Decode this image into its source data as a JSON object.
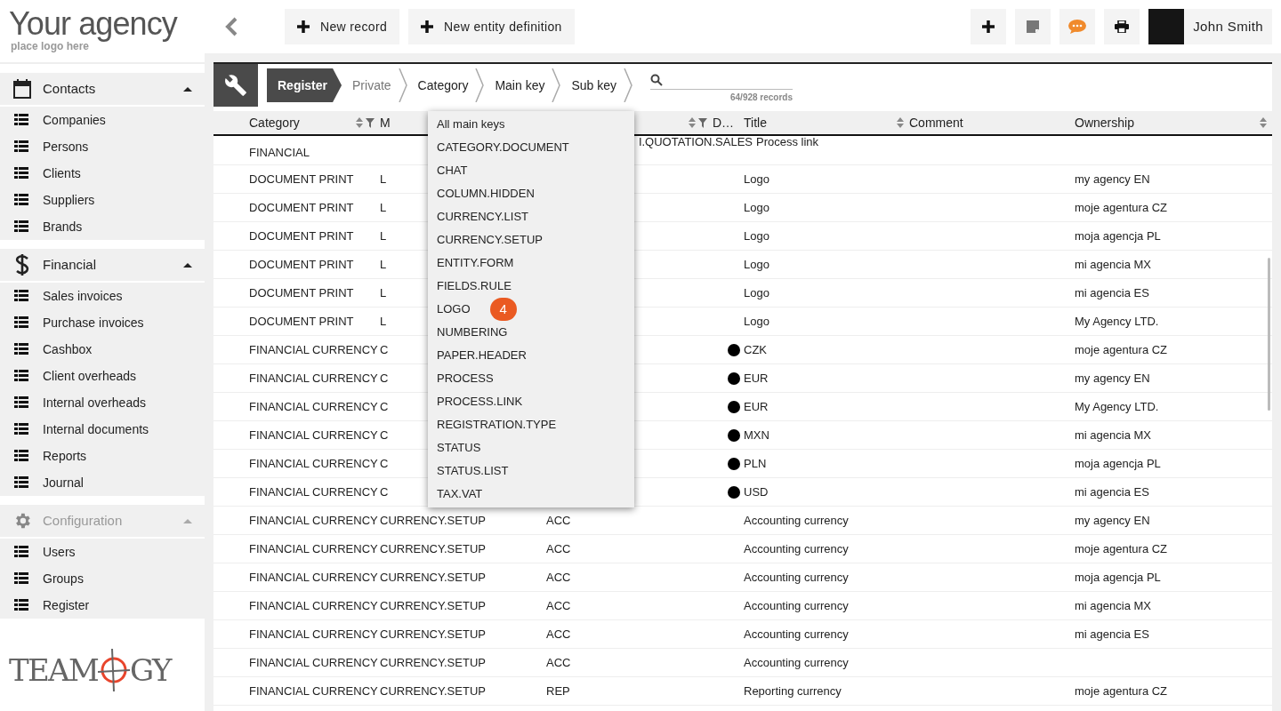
{
  "logo": {
    "title": "Your agency",
    "subtitle": "place logo here"
  },
  "toolbar": {
    "buttons": [
      {
        "label": "New record"
      },
      {
        "label": "New entity definition"
      }
    ],
    "icon_buttons": [
      {
        "kind": "plus"
      },
      {
        "kind": "note"
      },
      {
        "kind": "chat"
      },
      {
        "kind": "print"
      }
    ],
    "user": {
      "name": "John Smith"
    }
  },
  "sidebar": {
    "sections": [
      {
        "kind": "calendar",
        "label": "Contacts",
        "expanded": true,
        "disabled": false,
        "items": [
          "Companies",
          "Persons",
          "Clients",
          "Suppliers",
          "Brands"
        ]
      },
      {
        "kind": "dollar",
        "label": "Financial",
        "expanded": true,
        "disabled": false,
        "items": [
          "Sales invoices",
          "Purchase invoices",
          "Cashbox",
          "Client overheads",
          "Internal overheads",
          "Internal documents",
          "Reports",
          "Journal"
        ]
      },
      {
        "kind": "gear",
        "label": "Configuration",
        "expanded": true,
        "disabled": true,
        "items": [
          "Users",
          "Groups",
          "Register"
        ]
      }
    ],
    "brand": {
      "before": "TEAM",
      "after": "GY"
    }
  },
  "breadcrumb": [
    {
      "label": "Register",
      "selected": true,
      "disabled": false
    },
    {
      "label": "Private",
      "selected": false,
      "disabled": true
    },
    {
      "label": "Category",
      "selected": false,
      "disabled": false
    },
    {
      "label": "Main key",
      "selected": false,
      "disabled": false
    },
    {
      "label": "Sub key",
      "selected": false,
      "disabled": false
    }
  ],
  "search": {
    "count": "64/928 records"
  },
  "table": {
    "columns": [
      {
        "label": "Category",
        "sort": true,
        "filter": true
      },
      {
        "label": "M",
        "sort": false,
        "filter": false
      },
      {
        "sort": true,
        "filter": true
      },
      {
        "label": "D…",
        "sort": false,
        "filter": false
      },
      {
        "label": "Title",
        "sort": true,
        "filter": false
      },
      {
        "label": "Comment",
        "sort": false,
        "filter": false
      },
      {
        "label": "Ownership",
        "sort": true,
        "filter": false
      }
    ],
    "rows": [
      {
        "category": "FINANCIAL",
        "main_key": "",
        "sub_key": "",
        "covered_key_tail": "I.QUOTATION.SALES",
        "default": false,
        "title": "Process link",
        "ownership": ""
      },
      {
        "category": "DOCUMENT PRINT",
        "main_key": "L",
        "sub_key": "",
        "default": false,
        "title": "Logo",
        "ownership": "my agency EN"
      },
      {
        "category": "DOCUMENT PRINT",
        "main_key": "L",
        "sub_key": "",
        "default": false,
        "title": "Logo",
        "ownership": "moje agentura CZ"
      },
      {
        "category": "DOCUMENT PRINT",
        "main_key": "L",
        "sub_key": "",
        "default": false,
        "title": "Logo",
        "ownership": "moja agencja PL"
      },
      {
        "category": "DOCUMENT PRINT",
        "main_key": "L",
        "sub_key": "",
        "default": false,
        "title": "Logo",
        "ownership": "mi agencia MX"
      },
      {
        "category": "DOCUMENT PRINT",
        "main_key": "L",
        "sub_key": "",
        "default": false,
        "title": "Logo",
        "ownership": "mi agencia ES"
      },
      {
        "category": "DOCUMENT PRINT",
        "main_key": "L",
        "sub_key": "",
        "default": false,
        "title": "Logo",
        "ownership": "My Agency LTD."
      },
      {
        "category": "FINANCIAL CURRENCY",
        "main_key": "C",
        "sub_key": "",
        "default": true,
        "title": "CZK",
        "ownership": "moje agentura CZ"
      },
      {
        "category": "FINANCIAL CURRENCY",
        "main_key": "C",
        "sub_key": "",
        "default": true,
        "title": "EUR",
        "ownership": "my agency EN"
      },
      {
        "category": "FINANCIAL CURRENCY",
        "main_key": "C",
        "sub_key": "",
        "default": true,
        "title": "EUR",
        "ownership": "My Agency LTD."
      },
      {
        "category": "FINANCIAL CURRENCY",
        "main_key": "C",
        "sub_key": "",
        "default": true,
        "title": "MXN",
        "ownership": "mi agencia MX"
      },
      {
        "category": "FINANCIAL CURRENCY",
        "main_key": "C",
        "sub_key": "",
        "default": true,
        "title": "PLN",
        "ownership": "moja agencja PL"
      },
      {
        "category": "FINANCIAL CURRENCY",
        "main_key": "C",
        "sub_key": "",
        "default": true,
        "title": "USD",
        "ownership": "mi agencia ES"
      },
      {
        "category": "FINANCIAL CURRENCY",
        "main_key": "CURRENCY.SETUP",
        "sub_key": "ACC",
        "default": false,
        "title": "Accounting currency",
        "ownership": "my agency EN"
      },
      {
        "category": "FINANCIAL CURRENCY",
        "main_key": "CURRENCY.SETUP",
        "sub_key": "ACC",
        "default": false,
        "title": "Accounting currency",
        "ownership": "moje agentura CZ"
      },
      {
        "category": "FINANCIAL CURRENCY",
        "main_key": "CURRENCY.SETUP",
        "sub_key": "ACC",
        "default": false,
        "title": "Accounting currency",
        "ownership": "moja agencja PL"
      },
      {
        "category": "FINANCIAL CURRENCY",
        "main_key": "CURRENCY.SETUP",
        "sub_key": "ACC",
        "default": false,
        "title": "Accounting currency",
        "ownership": "mi agencia MX"
      },
      {
        "category": "FINANCIAL CURRENCY",
        "main_key": "CURRENCY.SETUP",
        "sub_key": "ACC",
        "default": false,
        "title": "Accounting currency",
        "ownership": "mi agencia ES"
      },
      {
        "category": "FINANCIAL CURRENCY",
        "main_key": "CURRENCY.SETUP",
        "sub_key": "ACC",
        "default": false,
        "title": "Accounting currency",
        "ownership": ""
      },
      {
        "category": "FINANCIAL CURRENCY",
        "main_key": "CURRENCY.SETUP",
        "sub_key": "REP",
        "default": false,
        "title": "Reporting currency",
        "ownership": "moje agentura CZ"
      }
    ]
  },
  "dropdown": {
    "items": [
      {
        "label": "All main keys"
      },
      {
        "label": "CATEGORY.DOCUMENT"
      },
      {
        "label": "CHAT"
      },
      {
        "label": "COLUMN.HIDDEN"
      },
      {
        "label": "CURRENCY.LIST"
      },
      {
        "label": "CURRENCY.SETUP"
      },
      {
        "label": "ENTITY.FORM"
      },
      {
        "label": "FIELDS.RULE"
      },
      {
        "label": "LOGO",
        "badge": "4"
      },
      {
        "label": "NUMBERING"
      },
      {
        "label": "PAPER.HEADER"
      },
      {
        "label": "PROCESS"
      },
      {
        "label": "PROCESS.LINK"
      },
      {
        "label": "REGISTRATION.TYPE"
      },
      {
        "label": "STATUS"
      },
      {
        "label": "STATUS.LIST"
      },
      {
        "label": "TAX.VAT"
      }
    ]
  }
}
